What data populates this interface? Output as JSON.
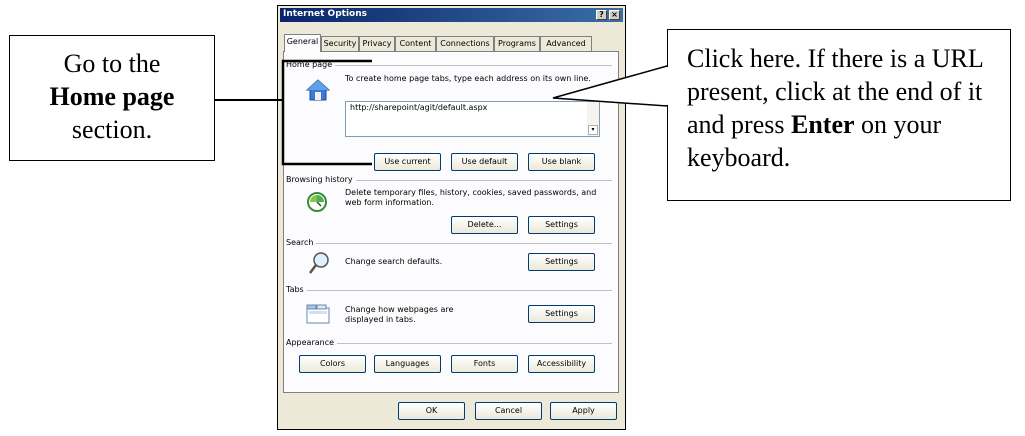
{
  "left_callout": {
    "line1": "Go to the",
    "bold": "Home page",
    "line3": "section."
  },
  "right_callout": {
    "text1": "Click here.  If there is a URL present, click at the end of it and press ",
    "bold": "Enter",
    "text2": " on your keyboard."
  },
  "dialog": {
    "title": "Internet Options",
    "help_label": "?",
    "close_label": "×",
    "tabs": [
      {
        "label": "General",
        "active": true
      },
      {
        "label": "Security"
      },
      {
        "label": "Privacy"
      },
      {
        "label": "Content"
      },
      {
        "label": "Connections"
      },
      {
        "label": "Programs"
      },
      {
        "label": "Advanced"
      }
    ],
    "home_page": {
      "label": "Home page",
      "description": "To create home page tabs, type each address on its own line.",
      "url": "http://sharepoint/agit/default.aspx",
      "scroll_arrow": "▾",
      "buttons": [
        "Use current",
        "Use default",
        "Use blank"
      ]
    },
    "browsing_history": {
      "label": "Browsing history",
      "description": "Delete temporary files, history, cookies, saved passwords, and web form information.",
      "delete_label": "Delete...",
      "settings_label": "Settings"
    },
    "search": {
      "label": "Search",
      "description": "Change search defaults.",
      "settings_label": "Settings"
    },
    "tabs_section": {
      "label": "Tabs",
      "description": "Change how webpages are displayed in tabs.",
      "settings_label": "Settings"
    },
    "appearance": {
      "label": "Appearance",
      "buttons": [
        "Colors",
        "Languages",
        "Fonts",
        "Accessibility"
      ]
    },
    "footer": {
      "ok": "OK",
      "cancel": "Cancel",
      "apply": "Apply"
    }
  },
  "colors": {
    "title_bar": "#0a246a",
    "dialog_face": "#ece9d8",
    "panel": "#fcfcfe"
  }
}
